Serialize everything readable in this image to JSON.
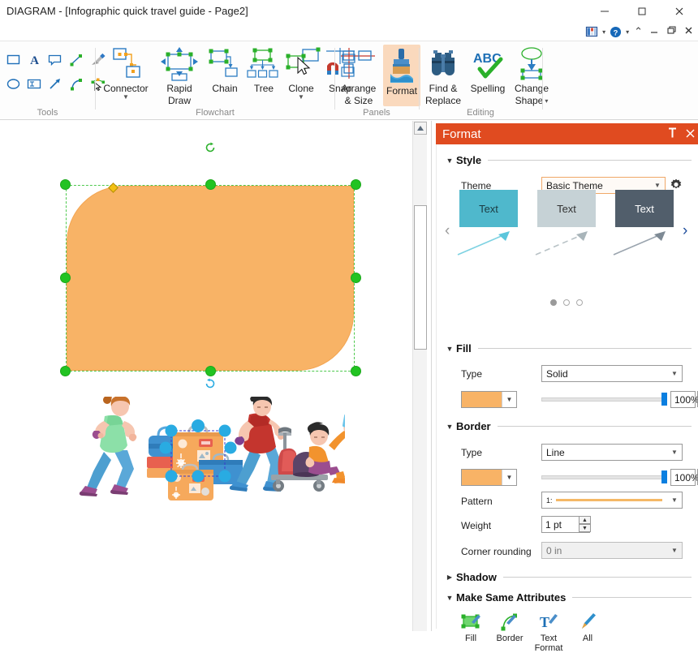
{
  "window": {
    "title": "DIAGRAM - [Infographic quick travel guide - Page2]",
    "minimize": "─",
    "maximize": "☐",
    "close": "✕"
  },
  "quick_access": {
    "panels_icon": "panels-icon",
    "caret1": "▾",
    "help_icon": "?",
    "caret2": "▾",
    "ribbon_collapse": "⌃",
    "doc_minimize": "—",
    "doc_restore": "❐",
    "doc_close": "✕"
  },
  "ribbon": {
    "groups": [
      {
        "name": "Tools"
      },
      {
        "name": "Flowchart"
      },
      {
        "name": "Panels"
      },
      {
        "name": "Editing"
      }
    ],
    "tools_icons": [
      "rectangle-tool-icon",
      "text-tool-icon",
      "callout-tool-icon",
      "line-tool-icon",
      "pen-tool-icon",
      "ellipse-tool-icon",
      "text-box-tool-icon",
      "arrow-tool-icon",
      "curve-tool-icon",
      "edit-points-tool-icon"
    ],
    "buttons": [
      {
        "label": "Connector",
        "icon": "connector-icon",
        "has_dropdown": true,
        "active": false
      },
      {
        "label": "Rapid\nDraw",
        "icon": "rapid-draw-icon",
        "has_dropdown": false,
        "active": false
      },
      {
        "label": "Chain",
        "icon": "chain-icon",
        "has_dropdown": false,
        "active": false
      },
      {
        "label": "Tree",
        "icon": "tree-icon",
        "has_dropdown": false,
        "active": false
      },
      {
        "label": "Clone",
        "icon": "clone-icon",
        "has_dropdown": true,
        "active": false
      },
      {
        "label": "Snap",
        "icon": "snap-icon",
        "has_dropdown": false,
        "active": false
      },
      {
        "label": "Arrange\n& Size",
        "icon": "arrange-size-icon",
        "has_dropdown": false,
        "active": false
      },
      {
        "label": "Format",
        "icon": "format-brush-icon",
        "has_dropdown": false,
        "active": true
      },
      {
        "label": "Find &\nReplace",
        "icon": "binoculars-icon",
        "has_dropdown": false,
        "active": false
      },
      {
        "label": "Spelling",
        "icon": "spelling-abc-check-icon",
        "has_dropdown": false,
        "active": false
      },
      {
        "label": "Change\nShape",
        "icon": "change-shape-icon",
        "has_dropdown": true,
        "active": false
      }
    ],
    "button_labels": {
      "connector": "Connector",
      "rapid_draw_l1": "Rapid",
      "rapid_draw_l2": "Draw",
      "chain": "Chain",
      "tree": "Tree",
      "clone": "Clone",
      "snap": "Snap",
      "arrange_l1": "Arrange",
      "arrange_l2": "& Size",
      "format": "Format",
      "find_l1": "Find &",
      "find_l2": "Replace",
      "spelling": "Spelling",
      "change_l1": "Change",
      "change_l2": "Shape",
      "abc": "ABC"
    },
    "group_labels": {
      "tools": "Tools",
      "flowchart": "Flowchart",
      "panels": "Panels",
      "editing": "Editing"
    }
  },
  "canvas": {
    "shape": {
      "name": "rounded-rectangle-shape",
      "fill": "#F8B366",
      "border": "#F3A552",
      "selected": true,
      "handle_color": "#22c322",
      "control_point_color": "#f3c012"
    },
    "illustration": {
      "name": "travel-people-illustration",
      "selected_group": "luggage-group",
      "selection_handle_color": "#29ABE2"
    },
    "scrollbar": {
      "up_arrow": "▲"
    }
  },
  "panel": {
    "title": "Format",
    "pin_icon": "✕",
    "pin_glyph": "╤",
    "close_icon": "✕",
    "sections": {
      "style": {
        "label": "Style",
        "expanded": true,
        "triangle": "▼"
      },
      "fill": {
        "label": "Fill",
        "expanded": true,
        "triangle": "▼"
      },
      "border": {
        "label": "Border",
        "expanded": true,
        "triangle": "▼"
      },
      "shadow": {
        "label": "Shadow",
        "expanded": false,
        "triangle": "▶"
      },
      "make_same": {
        "label": "Make Same Attributes",
        "expanded": true,
        "triangle": "▼"
      }
    },
    "style": {
      "theme_label": "Theme",
      "theme_value": "Basic Theme",
      "theme_settings_icon": "gear-icon",
      "prev_arrow": "‹",
      "next_arrow": "›",
      "cards": [
        {
          "text": "Text",
          "bg": "#4FB8CC",
          "fg": "#1c3b42",
          "arrow_color": "#7ed2e2",
          "arrow_style": "solid"
        },
        {
          "text": "Text",
          "bg": "#C6D2D6",
          "fg": "#333333",
          "arrow_color": "#b8c2c6",
          "arrow_style": "dashed"
        },
        {
          "text": "Text",
          "bg": "#515E6B",
          "fg": "#ffffff",
          "arrow_color": "#8d97a1",
          "arrow_style": "solid"
        }
      ],
      "page_dots": 3,
      "active_dot": 0
    },
    "fill": {
      "type_label": "Type",
      "type_value": "Solid",
      "color": "#F8B366",
      "opacity_value": "100%",
      "opacity_percent": 100
    },
    "border": {
      "type_label": "Type",
      "type_value": "Line",
      "color": "#F8B366",
      "opacity_value": "100%",
      "opacity_percent": 100,
      "pattern_label": "Pattern",
      "pattern_value": "1:",
      "pattern_color": "#F5B866",
      "weight_label": "Weight",
      "weight_value": "1 pt",
      "corner_label": "Corner rounding",
      "corner_value": "0 in"
    },
    "make_same": {
      "items": [
        {
          "label": "Fill",
          "icon": "fill-attribute-icon"
        },
        {
          "label": "Border",
          "icon": "border-attribute-icon"
        },
        {
          "label": "Text\nFormat",
          "icon": "text-format-attribute-icon"
        },
        {
          "label": "All",
          "icon": "all-attributes-icon"
        }
      ],
      "labels": {
        "fill": "Fill",
        "border": "Border",
        "text_l1": "Text",
        "text_l2": "Format",
        "all": "All"
      }
    }
  },
  "colors": {
    "panel_header": "#E04B20",
    "accent_orange": "#F8B366",
    "ribbon_active": "#FAD9BD",
    "slider_thumb": "#0a7fe0"
  }
}
